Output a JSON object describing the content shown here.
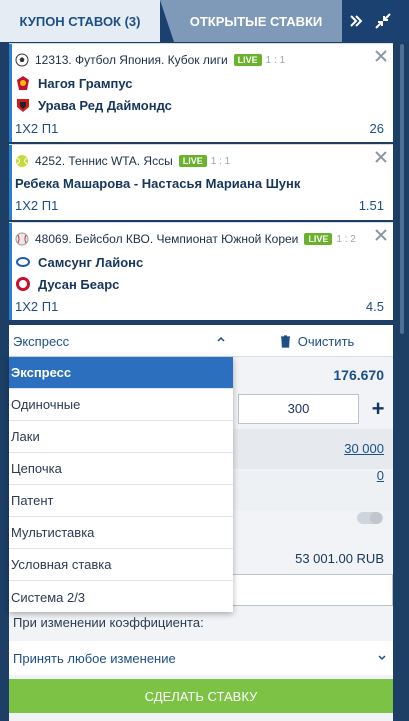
{
  "tabs": {
    "coupon": "КУПОН СТАВОК (3)",
    "open_bets": "ОТКРЫТЫЕ СТАВКИ"
  },
  "header_icons": [
    "double-chevron-right-icon",
    "collapse-arrows-icon"
  ],
  "bets": [
    {
      "sport_icon": "soccer-ball-icon",
      "event": "12313. Футбол Япония. Кубок лиги",
      "live": "LIVE",
      "score": "1 : 1",
      "team1": "Нагоя Грампус",
      "team2": "Урава Ред Даймондс",
      "market": "1X2 П1",
      "odd": "26"
    },
    {
      "sport_icon": "tennis-ball-icon",
      "event": "4252. Теннис WTA. Яссы",
      "live": "LIVE",
      "score": "1 : 1",
      "match": "Ребека Машарова - Настасья Мариана Шунк",
      "market": "1X2 П1",
      "odd": "1.51"
    },
    {
      "sport_icon": "baseball-icon",
      "event": "48069. Бейсбол КВО. Чемпионат Южной Кореи",
      "live": "LIVE",
      "score": "1 : 2",
      "team1": "Самсунг Лайонс",
      "team2": "Дусан Беарс",
      "market": "1X2 П1",
      "odd": "4.5"
    }
  ],
  "bet_type": {
    "selected": "Экспресс",
    "options": [
      "Экспресс",
      "Одиночные",
      "Лаки",
      "Цепочка",
      "Патент",
      "Мультиставка",
      "Условная ставка",
      "Система 2/3"
    ]
  },
  "clear_label": "Очистить",
  "total_odds": "176.670",
  "stake": "300",
  "plus": "+",
  "max_win": "30 000",
  "bonus": "0",
  "amount": "53 001.00 RUB",
  "odds_change_label": "При изменении коэффициента:",
  "odds_change_value": "Принять любое изменение",
  "place_bet": "СДЕЛАТЬ СТАВКУ",
  "colors": {
    "header": "#1b4170",
    "active_tab": "#e6ecf3",
    "inactive_tab": "#7f9ab9",
    "live_badge": "#68b22c",
    "accent_blue": "#2c6fbf",
    "place_button": "#7cc245"
  }
}
